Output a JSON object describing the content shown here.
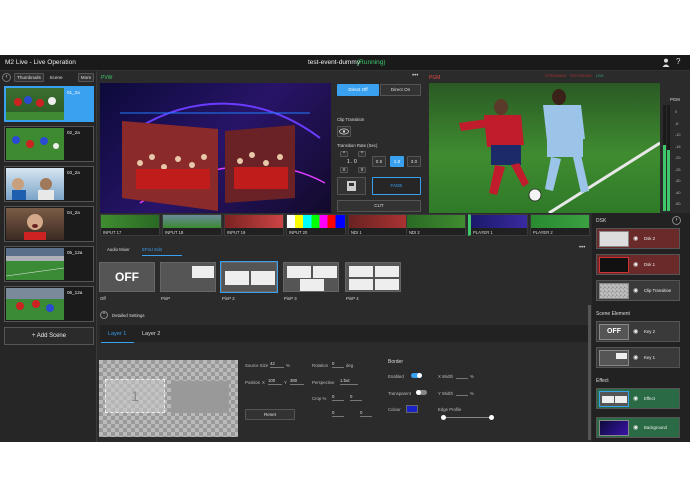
{
  "header": {
    "title": "M2 Live - Live Operation",
    "event_name": "test-event-dummy",
    "event_status": "(Running)",
    "user_icon": "user-icon",
    "help_icon": "help-icon"
  },
  "scenes": {
    "tabs": [
      "Thumbnails",
      "Scene",
      "More"
    ],
    "items": [
      {
        "name": "01_2a",
        "selected": true
      },
      {
        "name": "02_2a"
      },
      {
        "name": "03_2a"
      },
      {
        "name": "04_2a"
      },
      {
        "name": "05_12a"
      },
      {
        "name": "06_12a"
      }
    ],
    "add_label": "+ Add Scene"
  },
  "preview": {
    "label": "PVW",
    "more": "•••"
  },
  "program": {
    "label": "PGM",
    "status_tags": [
      "STREAMING",
      "RECORDING",
      "LIVE"
    ]
  },
  "transition": {
    "direct_off": "Direct Off",
    "direct_on": "Direct On",
    "clip_transition": "Clip Transition",
    "rate_label": "Transition Rate (Sec)",
    "rate_value": "1 . 0",
    "rates": [
      "0.5",
      "1.0",
      "3.0"
    ],
    "fade": "FADE",
    "cut": "CUT"
  },
  "audio_meter": {
    "label": "PGM",
    "scale": [
      "0",
      "-6",
      "-10",
      "-15",
      "-20",
      "-25",
      "-30",
      "-40",
      "-50"
    ]
  },
  "sources": [
    "INPUT 17",
    "INPUT 18",
    "INPUT 19",
    "INPUT 20",
    "NDI 1",
    "NDI 2",
    "PLAYER 1",
    "PLAYER 2"
  ],
  "mixer": {
    "tabs": [
      "Audio Mixer",
      "EPoU Edit"
    ],
    "patterns": [
      "Off",
      "PinP",
      "PinP 2",
      "PinP 3",
      "PinP 4"
    ],
    "off_text": "OFF",
    "detailed": "Detailed Settings",
    "layers": [
      "Layer 1",
      "Layer 2"
    ],
    "fields": {
      "source_size": "Source Size",
      "source_size_val": "42",
      "source_size_unit": "%",
      "position": "Position",
      "pos_x": "100",
      "pos_y": "380",
      "rotation": "Rotation",
      "rotation_val": "0",
      "rotation_unit": "deg",
      "perspective": "Perspective",
      "perspective_val": "1.but",
      "crop": "Crop %",
      "crop_vals": [
        "0",
        "0",
        "0",
        "0"
      ],
      "reset": "Reset",
      "border": "Border",
      "enabled": "Enabled",
      "transparent": "Transparent",
      "colour": "Colour",
      "edge_profile": "Edge Profile",
      "x_width": "X Width",
      "y_width": "Y Width",
      "pct": "%",
      "layer_number": "1"
    }
  },
  "dsk": {
    "title": "DSK",
    "items": [
      "Dsk 2",
      "Dsk 1",
      "Clip Transition"
    ],
    "scene_element_title": "Scene Element",
    "scene_elements": [
      "Key 2",
      "Key 1"
    ],
    "effect_title": "Effect",
    "effects": [
      "Effect",
      "Background"
    ],
    "off_text": "OFF"
  }
}
